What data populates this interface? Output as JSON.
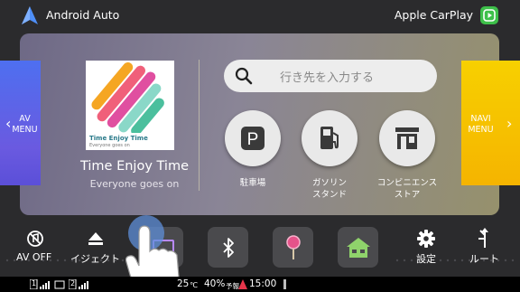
{
  "header": {
    "left_title": "Android Auto",
    "right_title": "Apple CarPlay"
  },
  "side": {
    "left_line1": "AV",
    "left_line2": "MENU",
    "right_line1": "NAVI",
    "right_line2": "MENU"
  },
  "media": {
    "album_title": "Time Enjoy Time",
    "album_subtitle": "Everyone goes on",
    "song_title": "Time Enjoy Time",
    "artist": "Everyone goes on"
  },
  "search": {
    "placeholder": "行き先を入力する"
  },
  "poi": [
    {
      "label": "駐車場",
      "icon": "parking-icon"
    },
    {
      "label": "ガソリン\nスタンド",
      "icon": "gas-station-icon"
    },
    {
      "label": "コンビニエンス\nストア",
      "icon": "convenience-store-icon"
    }
  ],
  "bottom": {
    "av_off": "AV OFF",
    "eject": "イジェクト",
    "settings": "設定",
    "route": "ルート"
  },
  "status": {
    "temp": "25",
    "temp_unit": "℃",
    "humidity": "40%",
    "forecast": "予報",
    "time": "15:00",
    "sim1": "1",
    "sim2": "2"
  },
  "colors": {
    "av_menu": "#5b63e8",
    "navi_menu": "#f5c000",
    "carplay": "#3ec04a"
  }
}
